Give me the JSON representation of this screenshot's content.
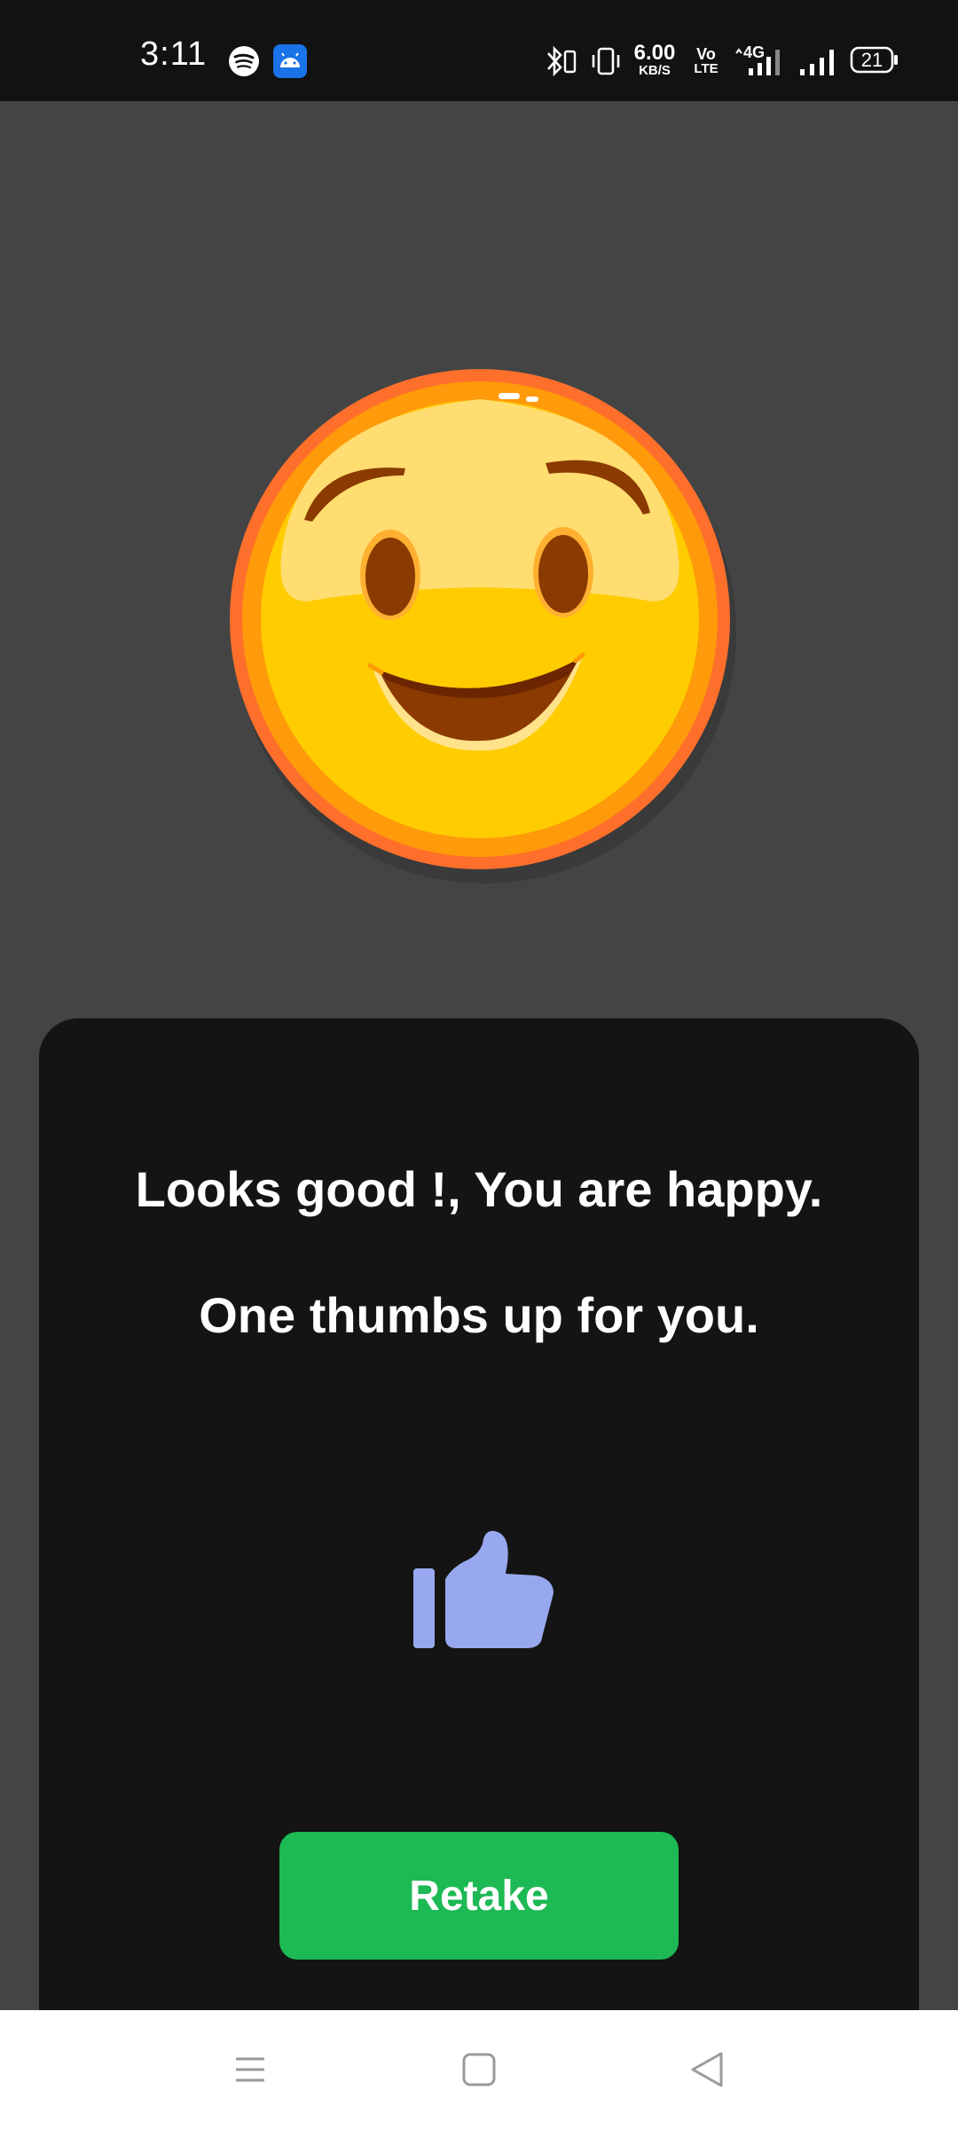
{
  "status_bar": {
    "time": "3:11",
    "network_speed_value": "6.00",
    "network_speed_unit": "KB/S",
    "volte_top": "Vo",
    "volte_bottom": "LTE",
    "network_type": "4G",
    "battery": "21"
  },
  "result": {
    "message_line1": "Looks good !, You are happy.",
    "message_line2": "One thumbs up for you.",
    "emoji_icon": "happy-face-icon",
    "reaction_icon": "thumbs-up-icon",
    "reaction_color": "#98a8ee"
  },
  "actions": {
    "retake_label": "Retake",
    "retake_color": "#1db954"
  },
  "nav_bar": {
    "menu_icon": "menu-icon",
    "home_icon": "home-square-icon",
    "back_icon": "back-triangle-icon"
  }
}
